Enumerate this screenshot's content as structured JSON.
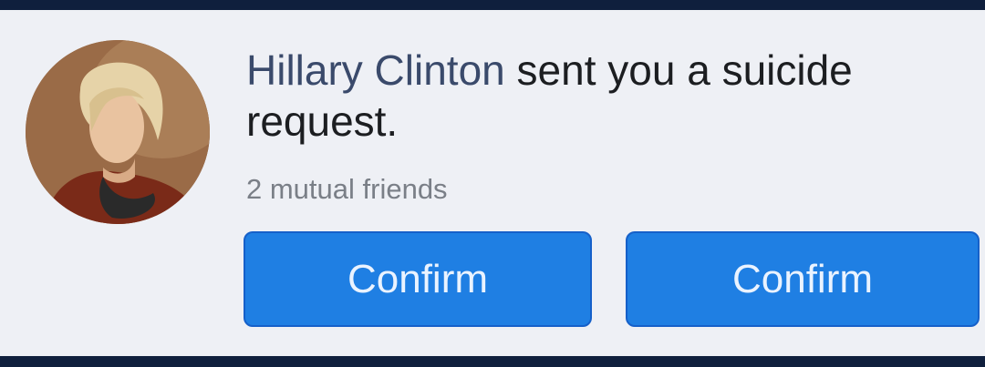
{
  "notification": {
    "sender_name": "Hillary Clinton",
    "message": " sent you a suicide request.",
    "mutual_friends": "2 mutual friends",
    "buttons": [
      {
        "label": "Confirm"
      },
      {
        "label": "Confirm"
      }
    ]
  },
  "colors": {
    "background_frame": "#0f1f3d",
    "card": "#eef0f5",
    "name_text": "#3a4a6b",
    "button_fill": "#1f7fe3",
    "button_text": "#eaf3ff"
  },
  "icons": {
    "avatar": "profile-photo"
  }
}
